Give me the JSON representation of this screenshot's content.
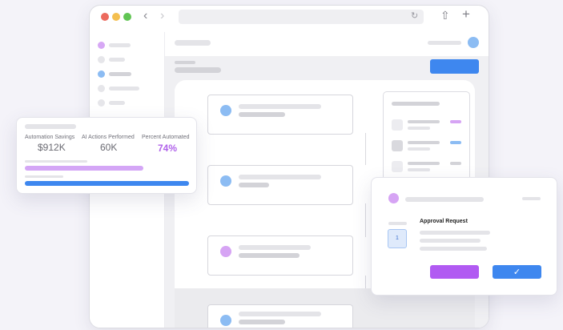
{
  "stats": {
    "automation_savings_label": "Automation Savings",
    "automation_savings_value": "$912K",
    "ai_actions_label": "AI Actions Performed",
    "ai_actions_value": "60K",
    "percent_automated_label": "Percent Automated",
    "percent_automated_value": "74%"
  },
  "approval": {
    "title": "Approval Request",
    "step_number": "1",
    "confirm_icon": "check-icon"
  },
  "colors": {
    "accent_blue": "#3e87ef",
    "accent_purple": "#b15af2",
    "node_blue": "#8cbcf3",
    "node_purple": "#d6a4f4"
  },
  "icons": {
    "share": "share-icon",
    "add_tab": "plus-icon",
    "reload": "reload-icon",
    "back": "chevron-left-icon",
    "forward": "chevron-right-icon"
  }
}
